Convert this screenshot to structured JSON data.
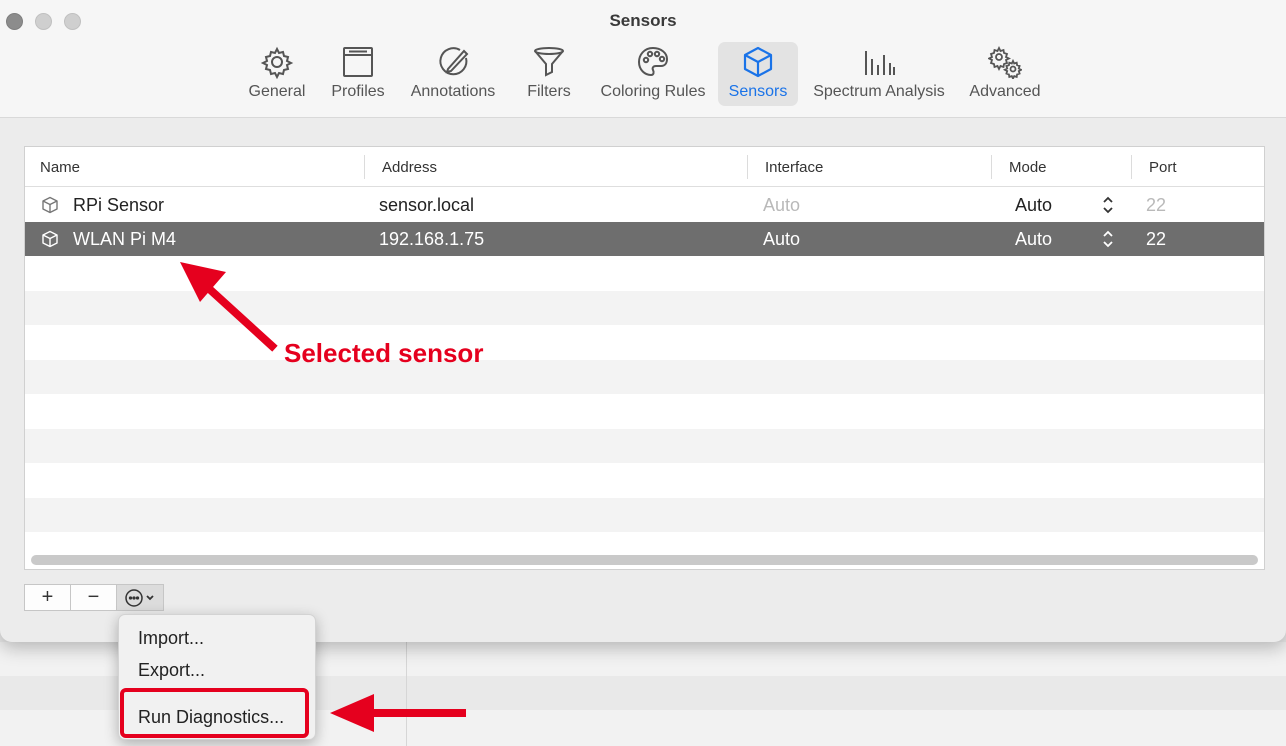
{
  "window": {
    "title": "Sensors"
  },
  "toolbar": {
    "tabs": [
      {
        "label": "General",
        "icon": "gear-icon"
      },
      {
        "label": "Profiles",
        "icon": "window-icon"
      },
      {
        "label": "Annotations",
        "icon": "pen-circle-icon"
      },
      {
        "label": "Filters",
        "icon": "funnel-icon"
      },
      {
        "label": "Coloring Rules",
        "icon": "palette-icon"
      },
      {
        "label": "Sensors",
        "icon": "cube-icon",
        "active": true
      },
      {
        "label": "Spectrum Analysis",
        "icon": "spectrum-bars-icon"
      },
      {
        "label": "Advanced",
        "icon": "gears-icon"
      }
    ],
    "active_color": "#1a73e8"
  },
  "table": {
    "columns": [
      "Name",
      "Address",
      "Interface",
      "Mode",
      "Port"
    ],
    "rows": [
      {
        "name": "RPi Sensor",
        "address": "sensor.local",
        "interface": "Auto",
        "mode": "Auto",
        "port": "22",
        "selected": false
      },
      {
        "name": "WLAN Pi M4",
        "address": "192.168.1.75",
        "interface": "Auto",
        "mode": "Auto",
        "port": "22",
        "selected": true
      }
    ]
  },
  "buttons": {
    "add": "+",
    "remove": "−"
  },
  "context_menu": {
    "items": [
      "Import...",
      "Export...",
      "Run Diagnostics..."
    ]
  },
  "annotations": {
    "selected_label": "Selected sensor",
    "color": "#e5001e"
  }
}
